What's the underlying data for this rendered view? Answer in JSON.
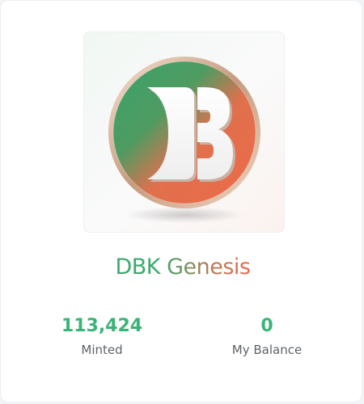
{
  "collection": {
    "title_part1": "DBK ",
    "title_part2": "Genesis",
    "logo_letters": "DB"
  },
  "stats": [
    {
      "value": "113,424",
      "label": "Minted"
    },
    {
      "value": "0",
      "label": "My Balance"
    }
  ],
  "colors": {
    "brand_green": "#3ea86e",
    "brand_orange": "#e8694e",
    "ring_gold": "#d7b59c",
    "stat_value": "#39b477",
    "stat_label": "#5f6468"
  }
}
